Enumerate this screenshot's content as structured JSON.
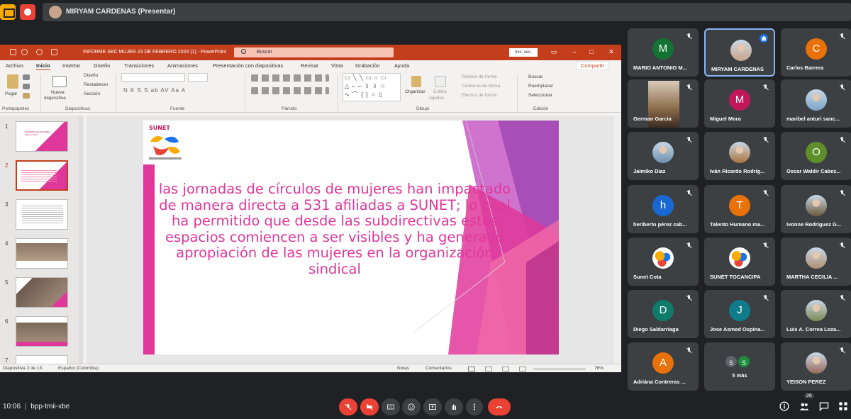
{
  "presenter": {
    "label": "MIRYAM CARDENAS (Presentar)"
  },
  "ppt": {
    "title": "INFORME SEC  MUJER 23 DE FEBRERO 2024 (1)  -  PowerPoint",
    "search": "Buscar",
    "login": "Inic. ses.",
    "share": "Compartir",
    "menu": [
      "Archivo",
      "Inicio",
      "Insertar",
      "Diseño",
      "Transiciones",
      "Animaciones",
      "Presentación con diapositivas",
      "Revisar",
      "Vista",
      "Grabación",
      "Ayuda"
    ],
    "ribbon": {
      "paste": "Pegar",
      "new_slide": "Nueva",
      "new_slide2": "diapositiva",
      "layout": "Diseño",
      "reset": "Restablecer",
      "section": "Sección",
      "arrange": "Organizar",
      "quick_styles": "Estilos",
      "quick_styles2": "rápidos",
      "fill": "Relleno de forma",
      "outline": "Contorno de forma",
      "effects": "Efectos de forma",
      "find": "Buscar",
      "replace": "Reemplazar",
      "select": "Seleccionar",
      "groups": [
        "Portapapeles",
        "Diapositivas",
        "Fuente",
        "Párrafo",
        "Dibujo",
        "Edición"
      ],
      "font_buttons": "N  K  S  S  ab  AV  Aa  A"
    },
    "slide_text": "las jornadas de círculos de mujeres han impactado de manera directa a 531 afiliadas a SUNET; lo cual ha permitido que desde las subdirectivas estos espacios comiencen a ser visibles y ha generado apropiación de las mujeres en la organización sindical",
    "thumbnails": [
      "1",
      "2",
      "3",
      "4",
      "5",
      "6",
      "7"
    ],
    "thumb1_text": "INFORME SEC MUJERES Febrero 2024",
    "status": {
      "slide": "Diapositiva 2 de 13",
      "lang": "Español (Colombia)",
      "notes": "Notas",
      "comments": "Comentarios",
      "zoom": "76%"
    }
  },
  "participants": [
    {
      "name": "MARIO ANTONIO M...",
      "initial": "M",
      "color": "#137333"
    },
    {
      "name": "MIRYAM CARDENAS",
      "initial": "",
      "color": "#c8a48a"
    },
    {
      "name": "Carlos Barrera",
      "initial": "C",
      "color": "#e8710a"
    },
    {
      "name": "German Garcia",
      "initial": "",
      "color": "#8b6b4a"
    },
    {
      "name": "Miguel Mora",
      "initial": "M",
      "color": "#c2185b"
    },
    {
      "name": "maribel anturi sanc...",
      "initial": "",
      "color": "#7aa6c8"
    },
    {
      "name": "Jaimiko Diaz",
      "initial": "",
      "color": "#6d8fae"
    },
    {
      "name": "Iván Ricardo Rodríg...",
      "initial": "",
      "color": "#a9753f"
    },
    {
      "name": "Oscar Waldir Cabez...",
      "initial": "O",
      "color": "#5f8f2a"
    },
    {
      "name": "heriberto pérez cab...",
      "initial": "h",
      "color": "#1967d2"
    },
    {
      "name": "Talento Humano ma...",
      "initial": "T",
      "color": "#e8710a"
    },
    {
      "name": "Ivonne Rodriguez G...",
      "initial": "",
      "color": "#6b5a3a"
    },
    {
      "name": "Sunet Cota",
      "initial": "",
      "color": "#ffffff"
    },
    {
      "name": "SUNET TOCANCIPA",
      "initial": "",
      "color": "#ffffff"
    },
    {
      "name": "MARTHA CECILIA ...",
      "initial": "",
      "color": "#b08f70"
    },
    {
      "name": "Diego Saldarriaga",
      "initial": "D",
      "color": "#0f7c6b"
    },
    {
      "name": "Jose Asmed Ospina...",
      "initial": "J",
      "color": "#0f7c8c"
    },
    {
      "name": "Luis A. Correa Loza...",
      "initial": "",
      "color": "#7d8a55"
    },
    {
      "name": "Adriána Contreras ...",
      "initial": "A",
      "color": "#e8710a"
    },
    {
      "name": "5 más",
      "initial": "S",
      "color": "#5f6368"
    },
    {
      "name": "YEISON PEREZ",
      "initial": "",
      "color": "#9a6a5a"
    }
  ],
  "bottom": {
    "time": "10:06",
    "separator": "|",
    "code": "bpp-tmii-xbe",
    "count": "26",
    "cc": "CC"
  },
  "colors": {
    "accent": "#c43e1c",
    "slide_text": "#e0379a",
    "end_call": "#ea4335"
  }
}
